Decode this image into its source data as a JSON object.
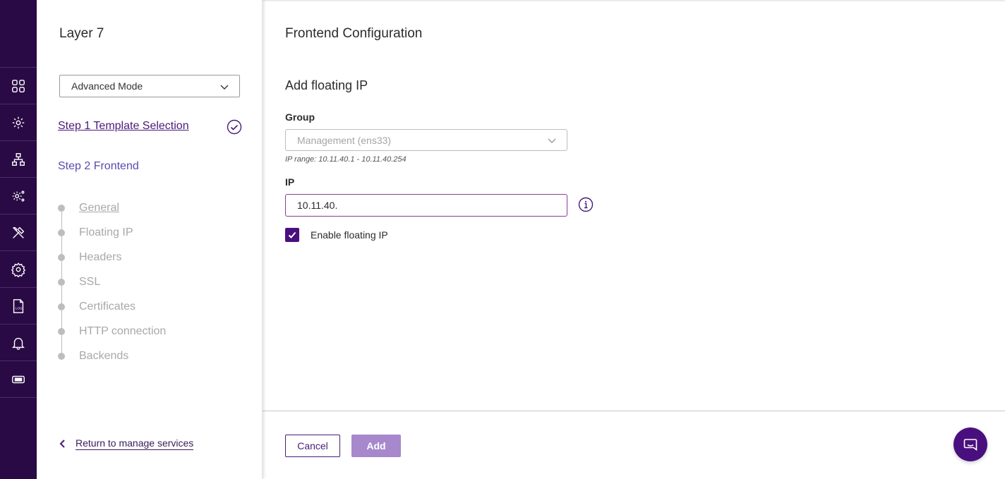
{
  "rail": {
    "icons": [
      "dashboard-icon",
      "services-icon",
      "network-icon",
      "system-settings-icon",
      "tools-icon",
      "settings-icon",
      "log-icon",
      "bell-icon",
      "ticket-icon"
    ],
    "log_icon_text": "LOG"
  },
  "steps_panel": {
    "title": "Layer 7",
    "mode_select": {
      "value": "Advanced Mode"
    },
    "step1": {
      "label": "Step 1 Template Selection",
      "completed": true
    },
    "step2": {
      "label": "Step 2 Frontend"
    },
    "sub_steps": [
      {
        "label": "General"
      },
      {
        "label": "Floating IP"
      },
      {
        "label": "Headers"
      },
      {
        "label": "SSL"
      },
      {
        "label": "Certificates"
      },
      {
        "label": "HTTP connection"
      },
      {
        "label": "Backends"
      }
    ],
    "return_link": "Return to manage services"
  },
  "main": {
    "title": "Frontend Configuration",
    "section_title": "Add floating IP",
    "group": {
      "label": "Group",
      "value": "Management (ens33)",
      "hint": "IP range: 10.11.40.1 - 10.11.40.254"
    },
    "ip": {
      "label": "IP",
      "value": "10.11.40."
    },
    "enable_floating_ip": {
      "label": "Enable floating IP",
      "checked": true
    },
    "buttons": {
      "cancel": "Cancel",
      "add": "Add"
    }
  },
  "colors": {
    "rail_bg": "#2a0a45",
    "accent": "#4a0f7e",
    "add_button_disabled": "#a888cc",
    "step2_text": "#5a4ab0"
  }
}
